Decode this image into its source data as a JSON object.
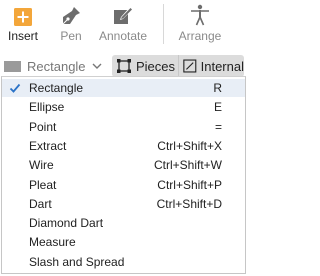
{
  "toolbar": {
    "insert": {
      "label": "Insert",
      "icon": "plus-square-icon",
      "color": "#f3a63a"
    },
    "pen": {
      "label": "Pen",
      "icon": "pen-nib-icon"
    },
    "annotate": {
      "label": "Annotate",
      "icon": "annotate-pencil-icon"
    },
    "arrange": {
      "label": "Arrange",
      "icon": "person-figure-icon"
    }
  },
  "selector": {
    "shape_value": "Rectangle",
    "pieces_label": "Pieces",
    "internal_label": "Internal"
  },
  "menu": {
    "items": [
      {
        "label": "Rectangle",
        "shortcut": "R",
        "checked": true
      },
      {
        "label": "Ellipse",
        "shortcut": "E"
      },
      {
        "label": "Point",
        "shortcut": "="
      },
      {
        "label": "Extract",
        "shortcut": "Ctrl+Shift+X"
      },
      {
        "label": "Wire",
        "shortcut": "Ctrl+Shift+W"
      },
      {
        "label": "Pleat",
        "shortcut": "Ctrl+Shift+P"
      },
      {
        "label": "Dart",
        "shortcut": "Ctrl+Shift+D"
      },
      {
        "label": "Diamond Dart",
        "shortcut": ""
      },
      {
        "label": "Measure",
        "shortcut": ""
      },
      {
        "label": "Slash and Spread",
        "shortcut": ""
      }
    ]
  },
  "colors": {
    "accent": "#f3a63a",
    "check": "#2b73c7",
    "segment_bg": "#dcdcdc"
  }
}
